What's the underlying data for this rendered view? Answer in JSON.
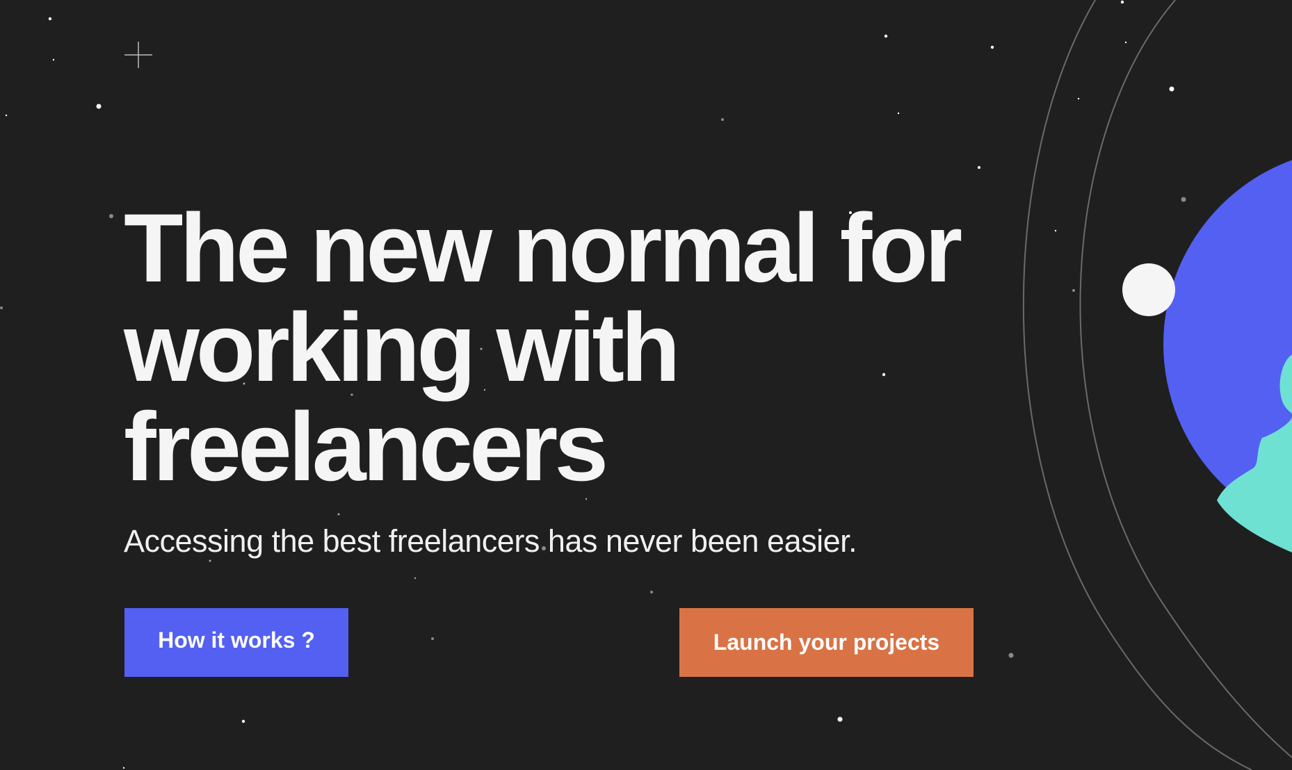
{
  "hero": {
    "headline_lines": [
      "The new normal for",
      "working with",
      "freelancers"
    ],
    "subtitle": "Accessing the best freelancers has never been easier."
  },
  "buttons": {
    "how_it_works": "How it works ?",
    "launch": "Launch your projects"
  },
  "colors": {
    "background": "#1f1f1f",
    "primary": "#5360f2",
    "accent": "#d97345",
    "planet": "#5360f2",
    "continent": "#6fe1d3",
    "moon": "#f5f5f5"
  },
  "icons": [
    "plus-sparkle-icon",
    "planet-illustration",
    "moon-illustration",
    "orbit-lines"
  ]
}
